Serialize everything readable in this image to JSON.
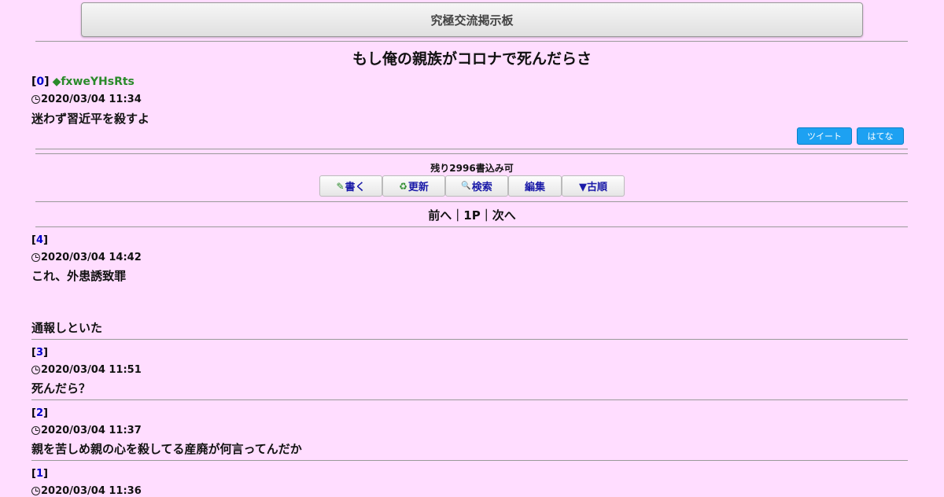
{
  "board_title": "究極交流掲示板",
  "thread_title": "もし俺の親族がコロナで死んだらさ",
  "op": {
    "num": "0",
    "trip": "◆fxweYHsRts",
    "date": "2020/03/04 11:34",
    "body": "迷わず習近平を殺すよ"
  },
  "share": {
    "tweet": "ツイート",
    "hatena": "はてな"
  },
  "remaining": "残り2996書込み可",
  "toolbar": {
    "write_icon": "✎",
    "write": "書く",
    "refresh_icon": "♻",
    "refresh": "更新",
    "search_icon": "🔍",
    "search": "検索",
    "edit": "編集",
    "order": "▼古順"
  },
  "pager": {
    "prev": "前へ",
    "sep1": "｜",
    "page": "1P",
    "sep2": "｜",
    "next": "次へ"
  },
  "posts": [
    {
      "num": "4",
      "date": "2020/03/04 14:42",
      "lines": [
        "これ、外患誘致罪",
        "通報しといた"
      ]
    },
    {
      "num": "3",
      "date": "2020/03/04 11:51",
      "lines": [
        "死んだら？"
      ]
    },
    {
      "num": "2",
      "date": "2020/03/04 11:37",
      "lines": [
        "親を苦しめ親の心を殺してる産廃が何言ってんだか"
      ]
    },
    {
      "num": "1",
      "date": "2020/03/04 11:36",
      "lines": []
    }
  ]
}
